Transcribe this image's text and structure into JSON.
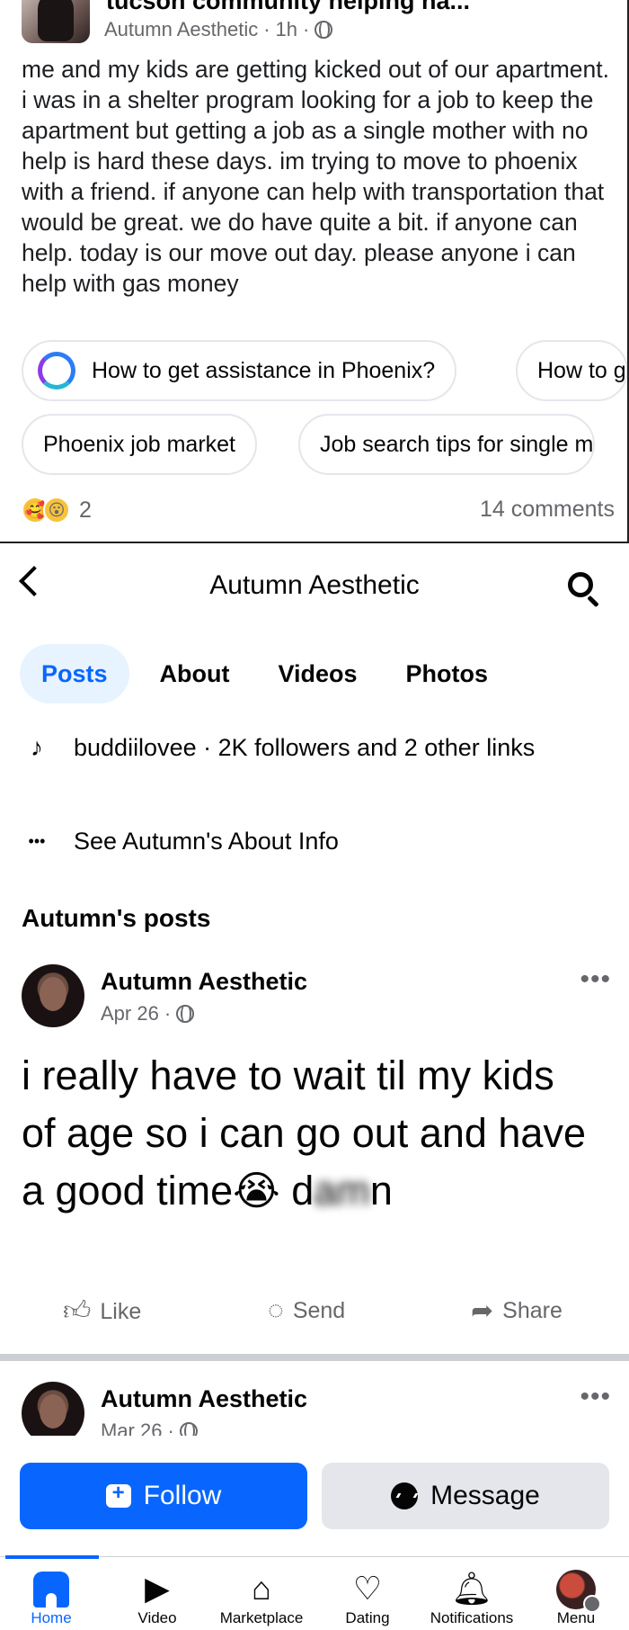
{
  "group_post": {
    "group_name": "tucson community helping ha...",
    "author": "Autumn Aesthetic",
    "time": "1h",
    "body": "me and my kids are getting kicked out of our apartment. i was in a shelter program looking for a job to keep the apartment but getting a job as a single mother with no help is hard these days. im trying to move to phoenix with a friend. if anyone can help with transportation that would be great. we do have quite a bit. if anyone can help. today is our move out day. please anyone i can help with gas money",
    "suggestions": [
      "How to get assistance in Phoenix?",
      "How to g",
      "Phoenix job market",
      "Job search tips for single m"
    ],
    "reaction_count": "2",
    "comments": "14 comments"
  },
  "profile": {
    "title": "Autumn Aesthetic",
    "tabs": [
      "Posts",
      "About",
      "Videos",
      "Photos"
    ],
    "links_text": "buddiilovee · 2K followers and 2 other links",
    "about_text": "See Autumn's About Info",
    "posts_heading": "Autumn's posts"
  },
  "post1": {
    "author": "Autumn Aesthetic",
    "date": "Apr 26",
    "text": "i really have to wait til my kids of age so i can go out and have a good time",
    "emoji": "😭",
    "censored_start": "d",
    "censored_mid": "am",
    "censored_end": "n",
    "actions": [
      "Like",
      "Send",
      "Share"
    ]
  },
  "post2": {
    "author": "Autumn Aesthetic",
    "date": "Mar 26"
  },
  "buttons": {
    "follow": "Follow",
    "message": "Message"
  },
  "bottom_nav": [
    "Home",
    "Video",
    "Marketplace",
    "Dating",
    "Notifications",
    "Menu"
  ],
  "colors": {
    "accent": "#0866ff",
    "secondary_button": "#e4e6eb",
    "muted_text": "#65676b"
  }
}
